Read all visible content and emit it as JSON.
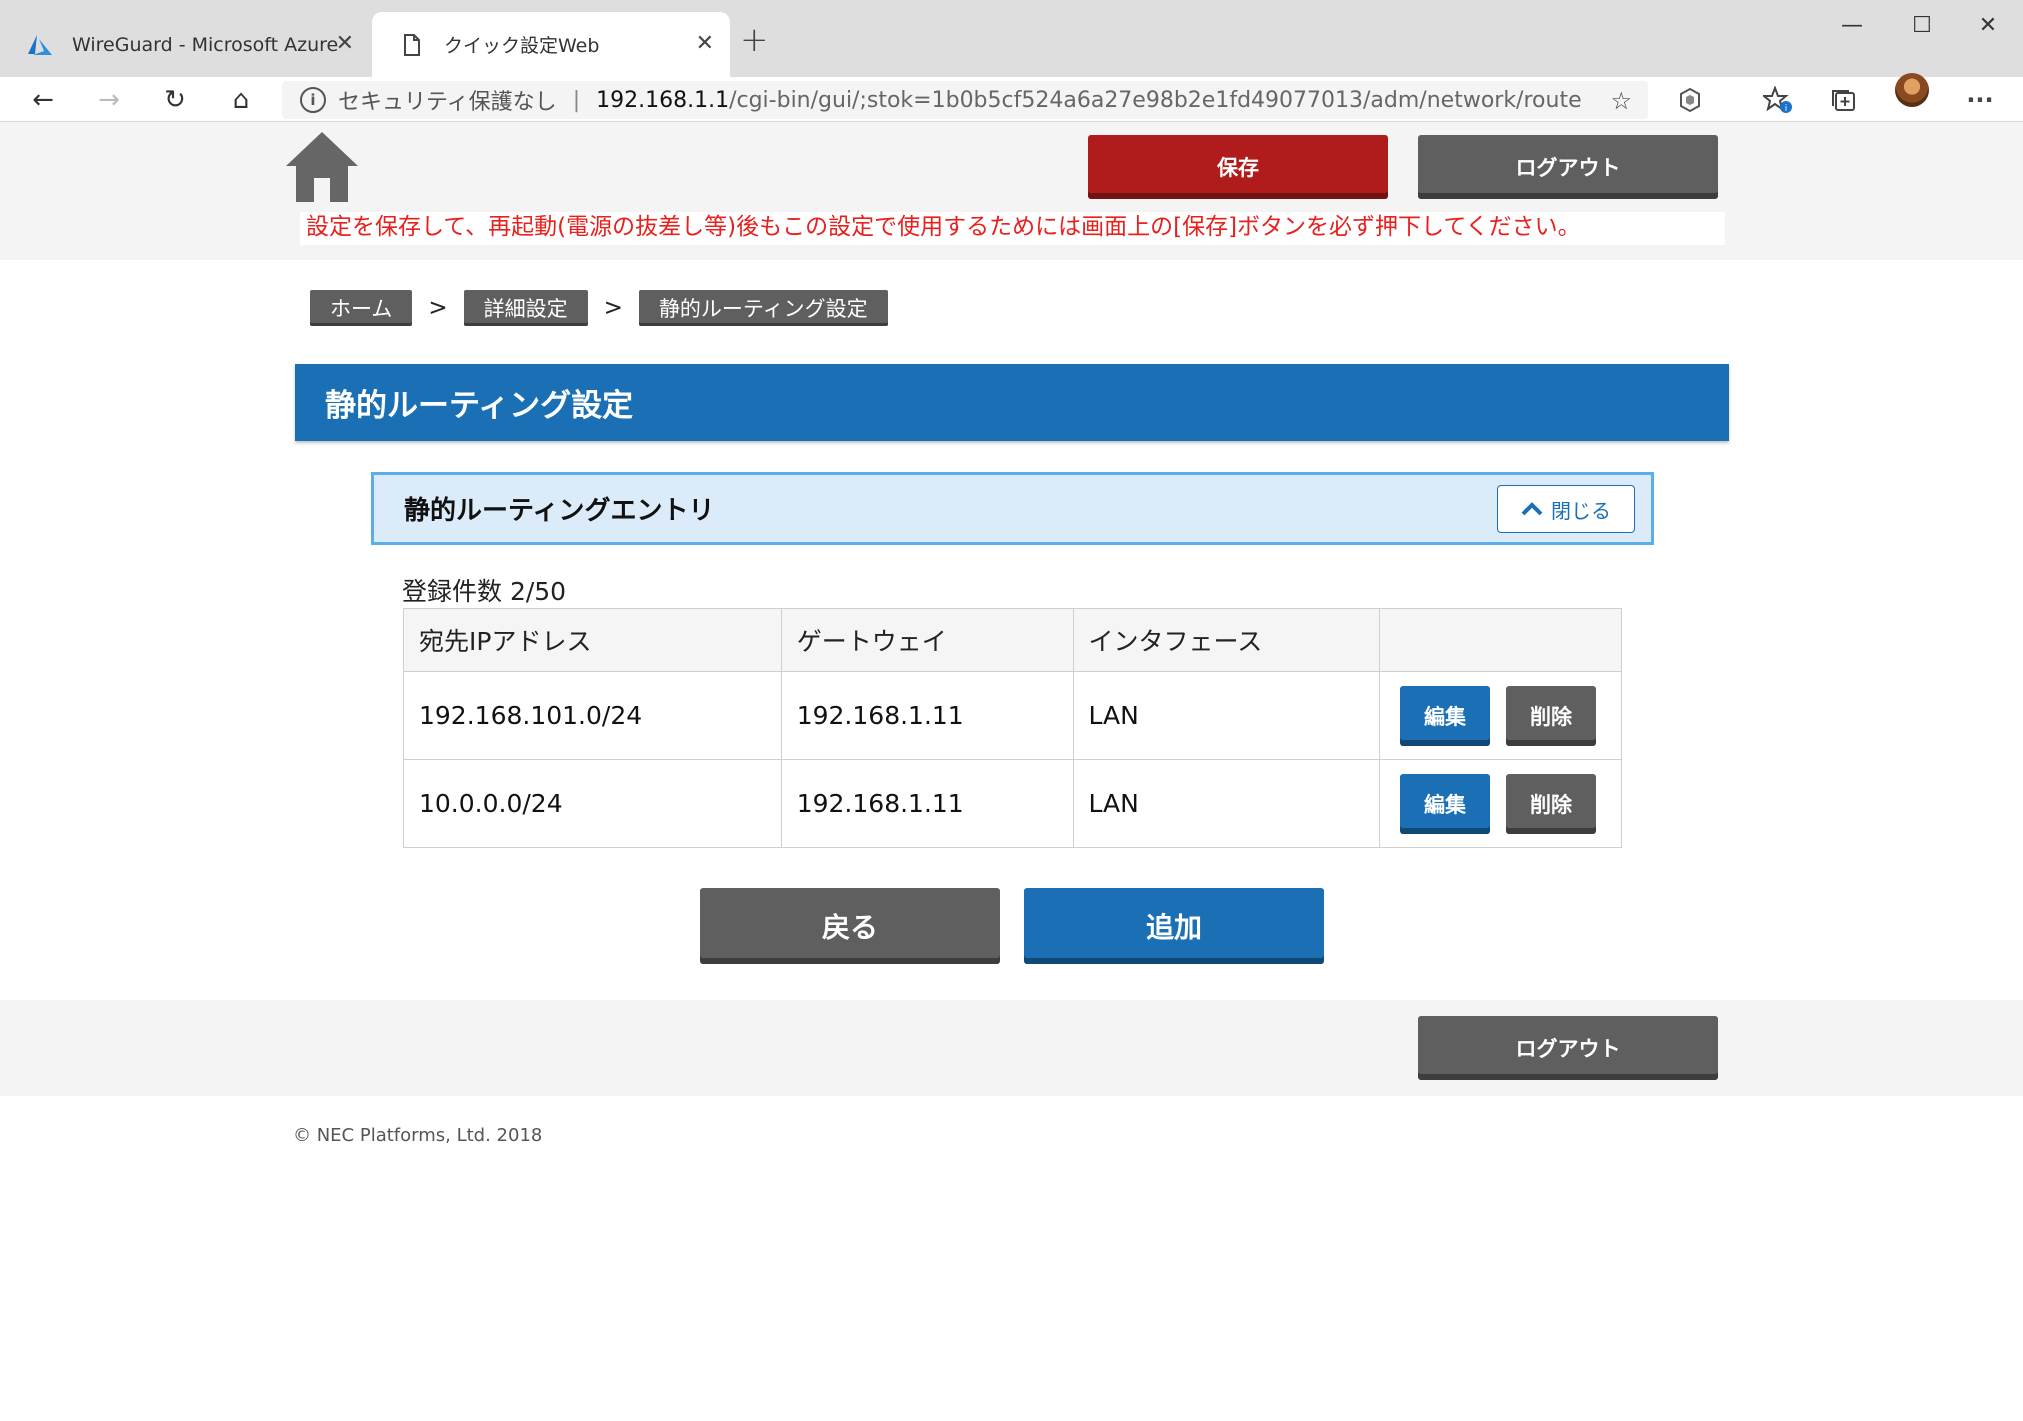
{
  "browser": {
    "tabs": [
      {
        "title": "WireGuard - Microsoft Azure",
        "icon": "azure-icon"
      },
      {
        "title": "クイック設定Web",
        "icon": "page-icon"
      }
    ],
    "address": {
      "security_label": "セキュリティ保護なし",
      "separator": "|",
      "host": "192.168.1.1",
      "path": "/cgi-bin/gui/;stok=1b0b5cf524a6a27e98b2e1fd49077013/adm/network/route"
    },
    "new_tab": "+",
    "controls": {
      "minimize": "—",
      "maximize": "☐",
      "close": "✕"
    },
    "toolbar": {
      "back": "←",
      "forward": "→",
      "refresh": "↻",
      "home": "⌂",
      "favorite": "☆",
      "more": "···"
    }
  },
  "header": {
    "save_label": "保存",
    "logout_label": "ログアウト",
    "notice": "設定を保存して、再起動(電源の抜差し等)後もこの設定で使用するためには画面上の[保存]ボタンを必ず押下してください。"
  },
  "breadcrumb": {
    "items": [
      "ホーム",
      "詳細設定",
      "静的ルーティング設定"
    ],
    "separator": ">"
  },
  "page_title": "静的ルーティング設定",
  "section": {
    "title": "静的ルーティングエントリ",
    "close_label": "閉じる"
  },
  "count_label": "登録件数 2/50",
  "table": {
    "headers": [
      "宛先IPアドレス",
      "ゲートウェイ",
      "インタフェース",
      ""
    ],
    "rows": [
      {
        "dest": "192.168.101.0/24",
        "gateway": "192.168.1.11",
        "iface": "LAN",
        "edit": "編集",
        "delete": "削除"
      },
      {
        "dest": "10.0.0.0/24",
        "gateway": "192.168.1.11",
        "iface": "LAN",
        "edit": "編集",
        "delete": "削除"
      }
    ]
  },
  "actions": {
    "back_label": "戻る",
    "add_label": "追加"
  },
  "footer": {
    "logout_label": "ログアウト",
    "copyright": "© NEC Platforms, Ltd. 2018"
  },
  "colors": {
    "brand_blue": "#1a6fb5",
    "save_red": "#b01c1c",
    "neutral_button": "#5f5f5f",
    "notice_red": "#e8201e",
    "section_border": "#5aaeea",
    "section_bg": "#dcebfa"
  }
}
